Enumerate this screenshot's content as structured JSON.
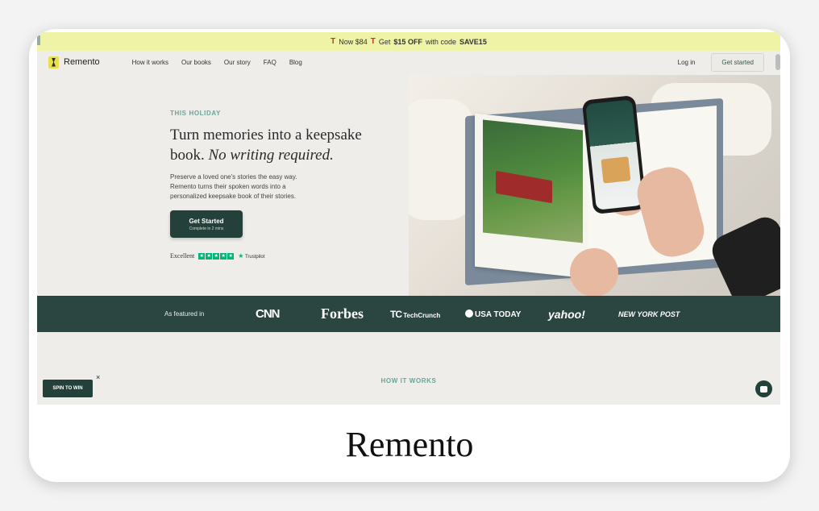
{
  "promo": {
    "price_text": "Now $84",
    "offer_prefix": "Get",
    "offer_amount": "$15 OFF",
    "offer_middle": "with code",
    "offer_code": "SAVE15",
    "gift_glyph": "🎁"
  },
  "nav": {
    "brand": "Remento",
    "links": [
      "How it works",
      "Our books",
      "Our story",
      "FAQ",
      "Blog"
    ],
    "login": "Log in",
    "cta": "Get started"
  },
  "hero": {
    "eyebrow": "THIS HOLIDAY",
    "headline_plain": "Turn memories into a keepsake book.",
    "headline_italic": "No writing required.",
    "description": "Preserve a loved one's stories the easy way. Remento turns their spoken words into a personalized keepsake book of their stories.",
    "button_title": "Get Started",
    "button_sub": "Complete in 2 mins",
    "rating_label": "Excellent",
    "rating_stars": 5,
    "trustpilot": "Trustpilot"
  },
  "featured": {
    "label": "As featured in",
    "outlets": {
      "cnn": "CNN",
      "forbes": "Forbes",
      "techcrunch": "TechCrunch",
      "usatoday": "USA TODAY",
      "yahoo": "yahoo!",
      "nypost": "NEW YORK POST"
    }
  },
  "how_it_works": "HOW IT WORKS",
  "spin": {
    "label": "SPIN TO WIN",
    "close": "×"
  },
  "caption": "Remento",
  "colors": {
    "promo_bg": "#eef3a6",
    "accent_dark": "#24403b",
    "accent_teal": "#6aa597",
    "trustpilot_green": "#00b67a"
  }
}
